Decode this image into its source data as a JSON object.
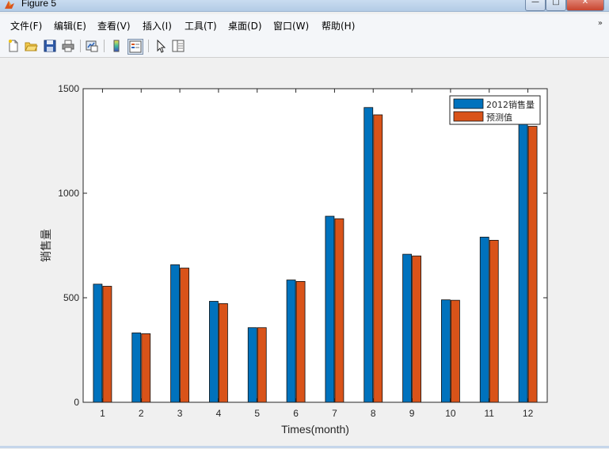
{
  "window": {
    "title": "Figure 5",
    "min_label": "—",
    "max_label": "□",
    "close_label": "✕"
  },
  "menu": [
    {
      "label": "文件(F)"
    },
    {
      "label": "编辑(E)"
    },
    {
      "label": "查看(V)"
    },
    {
      "label": "插入(I)"
    },
    {
      "label": "工具(T)"
    },
    {
      "label": "桌面(D)"
    },
    {
      "label": "窗口(W)"
    },
    {
      "label": "帮助(H)"
    }
  ],
  "menu_overflow_icon": "double-chevron-icon",
  "toolbar": [
    {
      "icon": "new-figure-icon"
    },
    {
      "icon": "open-file-icon"
    },
    {
      "icon": "save-icon"
    },
    {
      "icon": "print-icon"
    },
    {
      "icon": "link-plot-icon"
    },
    {
      "icon": "colorbar-icon"
    },
    {
      "icon": "legend-icon"
    },
    {
      "icon": "pointer-icon"
    },
    {
      "icon": "property-editor-icon"
    }
  ],
  "chart_data": {
    "type": "bar",
    "title": "",
    "xlabel": "Times(month)",
    "ylabel": "销售量",
    "categories": [
      "1",
      "2",
      "3",
      "4",
      "5",
      "6",
      "7",
      "8",
      "9",
      "10",
      "11",
      "12"
    ],
    "ylim": [
      0,
      1500
    ],
    "yticks": [
      0,
      500,
      1000,
      1500
    ],
    "grid": false,
    "legend_position": "top-right",
    "series": [
      {
        "name": "2012销售量",
        "color": "#0072bd",
        "values": [
          565,
          332,
          658,
          483,
          357,
          585,
          890,
          1410,
          708,
          490,
          790,
          1370
        ]
      },
      {
        "name": "预测值",
        "color": "#d95319",
        "values": [
          555,
          328,
          642,
          472,
          357,
          578,
          878,
          1375,
          700,
          488,
          775,
          1320
        ]
      }
    ]
  }
}
